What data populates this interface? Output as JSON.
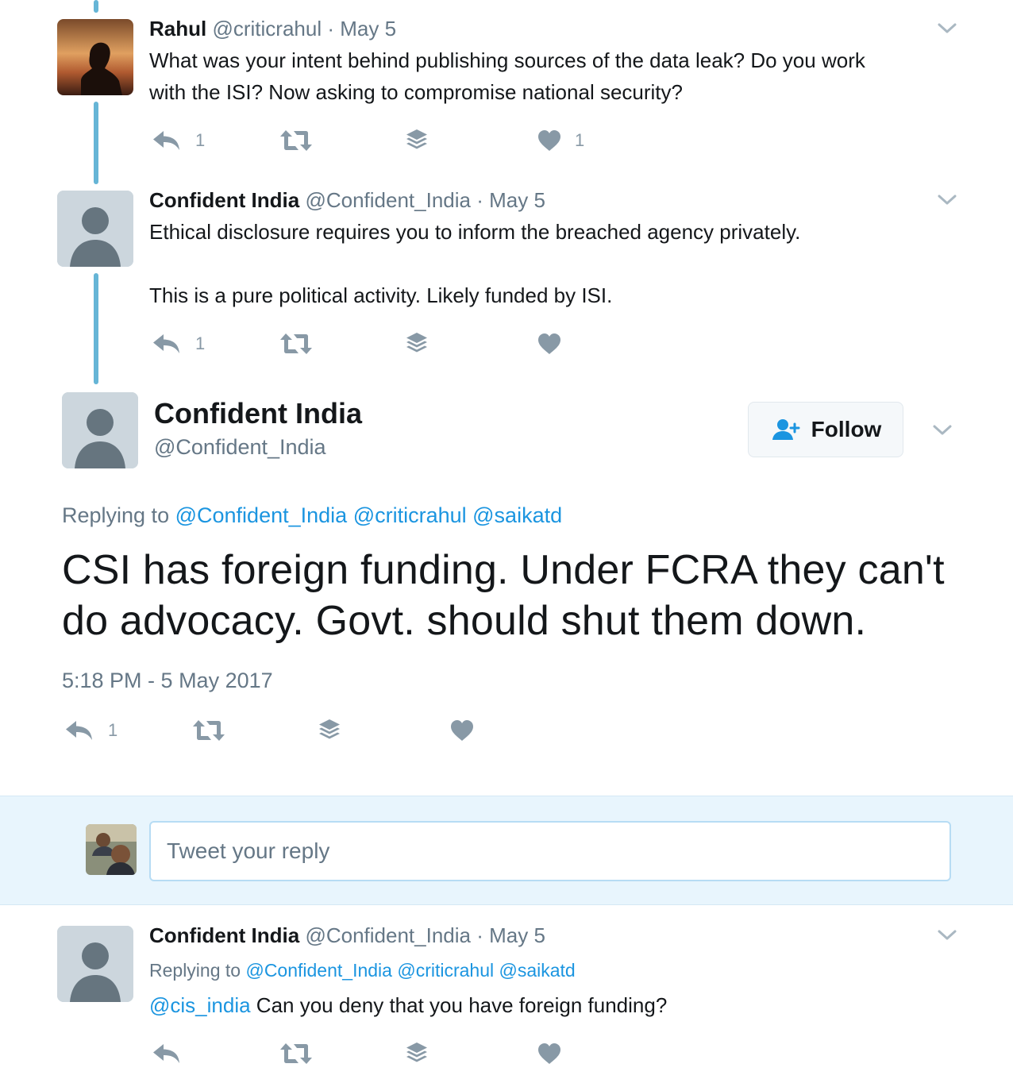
{
  "colors": {
    "accent": "#1b95e0",
    "thread_line": "#66b5d6",
    "muted": "#657786",
    "icon": "#8899a6"
  },
  "tweets": [
    {
      "name": "Rahul",
      "handle": "@criticrahul",
      "sep": "·",
      "date": "May 5",
      "text_lines": [
        "What was your intent behind publishing sources of the data leak? Do you work",
        "with the ISI? Now asking to compromise national security?"
      ],
      "reply_count": "1",
      "like_count": "1"
    },
    {
      "name": "Confident India",
      "handle": "@Confident_India",
      "sep": "·",
      "date": "May 5",
      "text_lines": [
        "Ethical disclosure requires you to inform the breached agency privately.",
        "This is a pure political activity. Likely funded by ISI."
      ],
      "reply_count": "1"
    }
  ],
  "main_tweet": {
    "name": "Confident India",
    "handle": "@Confident_India",
    "follow_label": "Follow",
    "replying_label": "Replying to",
    "replying_to": [
      "@Confident_India",
      "@criticrahul",
      "@saikatd"
    ],
    "text_lines": [
      "CSI has foreign funding. Under FCRA they can't",
      "do advocacy. Govt. should shut them down."
    ],
    "timestamp": "5:18 PM - 5 May 2017",
    "reply_count": "1"
  },
  "reply_box": {
    "placeholder": "Tweet your reply"
  },
  "last_tweet": {
    "name": "Confident India",
    "handle": "@Confident_India",
    "sep": "·",
    "date": "May 5",
    "replying_label": "Replying to",
    "replying_to": [
      "@Confident_India",
      "@criticrahul",
      "@saikatd"
    ],
    "mention": "@cis_india",
    "text": " Can you deny that you have foreign funding?"
  },
  "icons": [
    "reply-icon",
    "retweet-icon",
    "layers-icon",
    "heart-icon",
    "chevron-down-icon",
    "follow-person-icon"
  ]
}
